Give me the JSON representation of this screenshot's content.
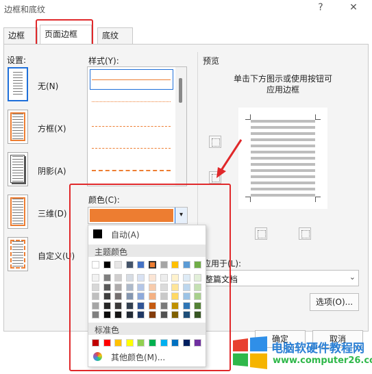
{
  "window": {
    "title": "边框和底纹",
    "help": "?",
    "close": "✕"
  },
  "tabs": [
    {
      "label": "边框(B)"
    },
    {
      "label": "页面边框(P)"
    },
    {
      "label": "底纹(S)"
    }
  ],
  "settings": {
    "label": "设置:",
    "items": [
      {
        "label": "无(N)"
      },
      {
        "label": "方框(X)"
      },
      {
        "label": "阴影(A)"
      },
      {
        "label": "三维(D)"
      },
      {
        "label": "自定义(U)"
      }
    ]
  },
  "style": {
    "label": "样式(Y):"
  },
  "color": {
    "label": "颜色(C):",
    "value_color": "#ED7D31"
  },
  "palette": {
    "auto_label": "自动(A)",
    "theme_label": "主题颜色",
    "standard_label": "标准色",
    "more_label": "其他颜色(M)...",
    "theme_top": [
      "#FFFFFF",
      "#000000",
      "#E7E6E6",
      "#44546A",
      "#4472C4",
      "#ED7D31",
      "#A5A5A5",
      "#FFC000",
      "#5B9BD5",
      "#70AD47"
    ],
    "theme_shades": [
      [
        "#F2F2F2",
        "#7F7F7F",
        "#D0CECE",
        "#D6DCE4",
        "#D9E2F3",
        "#FBE5D5",
        "#EDEDED",
        "#FFF2CC",
        "#DEEBF6",
        "#E2EFD9"
      ],
      [
        "#D8D8D8",
        "#595959",
        "#AEABAB",
        "#ADB9CA",
        "#B4C6E7",
        "#F7CBAC",
        "#DBDBDB",
        "#FEE599",
        "#BDD7EE",
        "#C5E0B3"
      ],
      [
        "#BFBFBF",
        "#3F3F3F",
        "#757070",
        "#8496B0",
        "#8EAADB",
        "#F4B183",
        "#C9C9C9",
        "#FFD965",
        "#9CC3E5",
        "#A8D08D"
      ],
      [
        "#A5A5A5",
        "#262626",
        "#3A3838",
        "#323F4F",
        "#2F5496",
        "#C55A11",
        "#7B7B7B",
        "#BF9000",
        "#2E75B5",
        "#538135"
      ],
      [
        "#7F7F7F",
        "#0C0C0C",
        "#171616",
        "#222A35",
        "#1F3864",
        "#833C0B",
        "#525252",
        "#7F6000",
        "#1E4E79",
        "#375623"
      ]
    ],
    "standard": [
      "#C00000",
      "#FF0000",
      "#FFC000",
      "#FFFF00",
      "#92D050",
      "#00B050",
      "#00B0F0",
      "#0070C0",
      "#002060",
      "#7030A0"
    ]
  },
  "preview": {
    "label": "预览",
    "hint_line1": "单击下方图示或使用按钮可",
    "hint_line2": "应用边框"
  },
  "apply_to": {
    "label": "应用于(L):",
    "value": "整篇文档"
  },
  "buttons": {
    "options": "选项(O)...",
    "ok": "确定",
    "cancel": "取消"
  },
  "watermark": {
    "line1": "电脑软硬件教程网",
    "line2": "www.computer26.com"
  }
}
